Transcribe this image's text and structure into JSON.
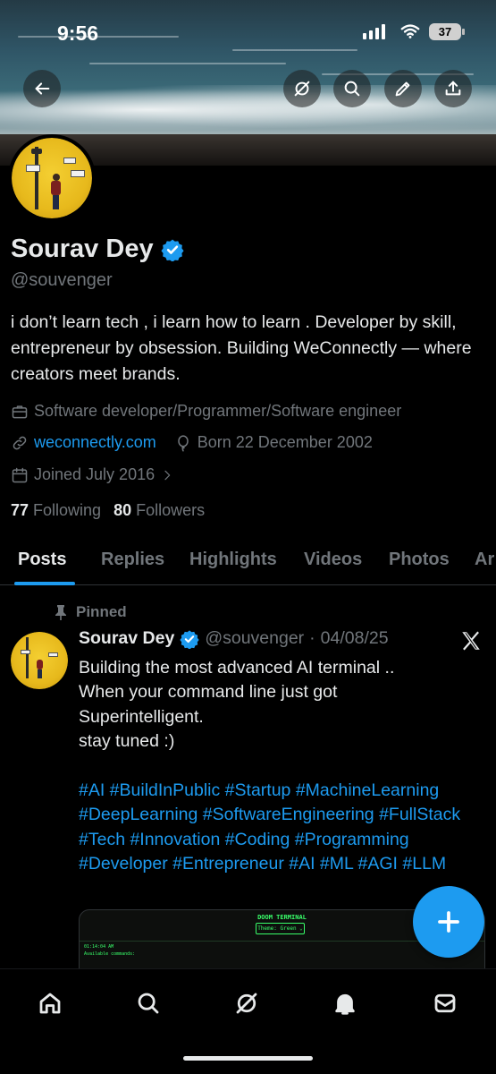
{
  "status": {
    "time": "9:56",
    "battery": "37"
  },
  "profile": {
    "name": "Sourav Dey",
    "handle": "@souvenger",
    "bio": "i don’t learn tech , i learn how to learn . Developer by skill, entrepreneur by obsession. Building WeConnectly — where creators meet brands.",
    "profession": "Software developer/Programmer/Software engineer",
    "website": "weconnectly.com",
    "birthday": "Born 22 December 2002",
    "joined": "Joined July 2016",
    "following_count": "77",
    "following_label": "Following",
    "followers_count": "80",
    "followers_label": "Followers"
  },
  "tabs": [
    "Posts",
    "Replies",
    "Highlights",
    "Videos",
    "Photos",
    "Ar"
  ],
  "post": {
    "pinned_label": "Pinned",
    "author": "Sourav Dey",
    "handle": "@souvenger",
    "separator": "·",
    "date": "04/08/25",
    "text": "Building the most advanced AI terminal ..\nWhen your command line just got\nSuperintelligent.\nstay tuned :)",
    "hashtags": "#AI #BuildInPublic #Startup #MachineLearning #DeepLearning #SoftwareEngineering #FullStack #Tech #Innovation #Coding #Programming #Developer #Entrepreneur #AI #ML #AGI #LLM",
    "media": {
      "title": "DOOM TERMINAL",
      "theme": "Theme: Green ⌄",
      "time": "01:14:04 AM",
      "line": "Available commands:"
    }
  },
  "colors": {
    "accent": "#1d9bf0",
    "text": "#e7e9ea",
    "muted": "#71767b",
    "background": "#000000"
  },
  "icons": [
    "back-arrow-icon",
    "grok-icon",
    "search-icon",
    "edit-pencil-icon",
    "share-icon",
    "verified-badge-icon",
    "briefcase-icon",
    "link-icon",
    "balloon-icon",
    "calendar-icon",
    "pin-icon",
    "x-logo-icon",
    "plus-icon",
    "home-icon",
    "bell-icon",
    "mail-icon"
  ]
}
